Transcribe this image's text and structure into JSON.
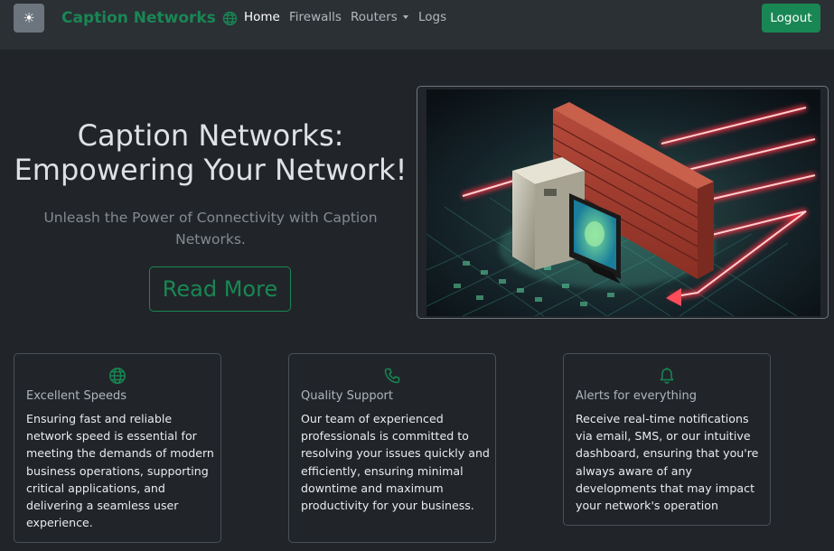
{
  "navbar": {
    "brand": "Caption Networks",
    "links": [
      "Home",
      "Firewalls",
      "Routers",
      "Logs"
    ],
    "logout_label": "Logout",
    "theme_icon": "sun-icon"
  },
  "hero": {
    "title": "Caption Networks: Empowering Your Network!",
    "subtitle": "Unleash the Power of Connectivity with Caption Networks.",
    "button_label": "Read More"
  },
  "features": [
    {
      "icon": "globe-icon",
      "title": "Excellent Speeds",
      "text": "Ensuring fast and reliable network speed is essential for meeting the demands of modern business operations, supporting critical applications, and delivering a seamless user experience."
    },
    {
      "icon": "phone-icon",
      "title": "Quality Support",
      "text": "Our team of experienced professionals is committed to resolving your issues quickly and efficiently, ensuring minimal downtime and maximum productivity for your business."
    },
    {
      "icon": "bell-icon",
      "title": "Alerts for everything",
      "text": "Receive real-time notifications via email, SMS, or our intuitive dashboard, ensuring that you're always aware of any developments that may impact your network's operation"
    }
  ],
  "colors": {
    "accent": "#198754",
    "background": "#212529",
    "navbar": "#2b3035"
  }
}
